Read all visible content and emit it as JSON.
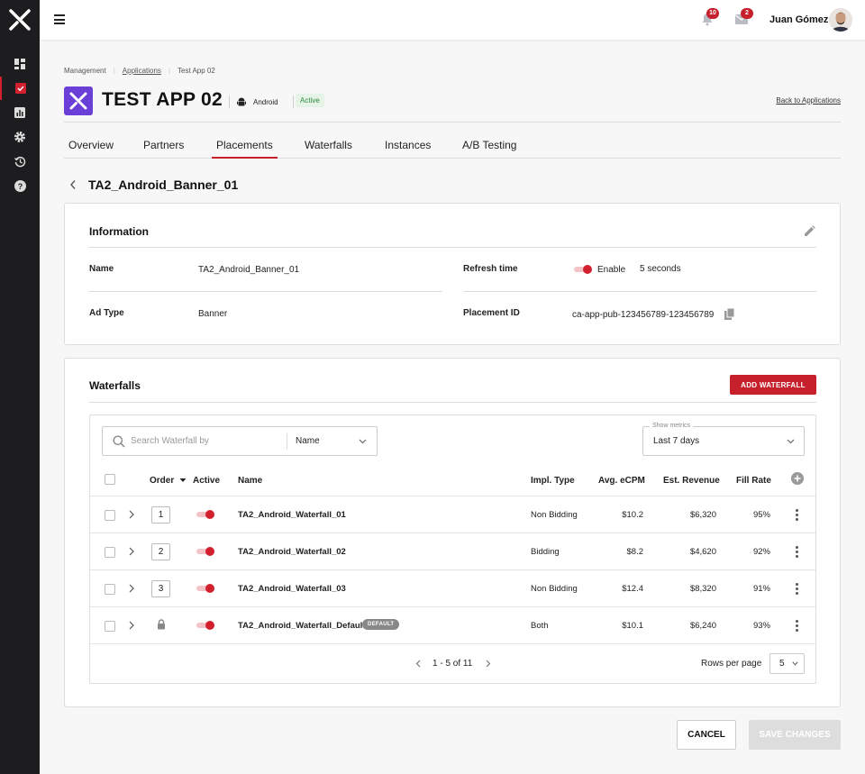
{
  "colors": {
    "brand_red": "#c6202d",
    "app_purple": "#6a3fd8",
    "sidebar": "#1d1d1f",
    "active_green": "#2e8a3d"
  },
  "sidebar": {
    "items": [
      {
        "icon": "dashboard-icon",
        "active": false
      },
      {
        "icon": "checkbox-icon",
        "active": true
      },
      {
        "icon": "bar-chart-icon",
        "active": false
      },
      {
        "icon": "gear-icon",
        "active": false
      },
      {
        "icon": "history-icon",
        "active": false
      },
      {
        "icon": "help-icon",
        "active": false
      }
    ]
  },
  "topbar": {
    "notifications_count": "10",
    "messages_count": "2",
    "user_name": "Juan Gómez"
  },
  "breadcrumb": {
    "items": [
      "Management",
      "Applications",
      "Test App 02"
    ]
  },
  "app": {
    "title": "TEST APP 02",
    "platform": "Android",
    "status": "Active",
    "back_link": "Back to Applications"
  },
  "tabs": [
    {
      "label": "Overview",
      "active": false
    },
    {
      "label": "Partners",
      "active": false
    },
    {
      "label": "Placements",
      "active": true
    },
    {
      "label": "Waterfalls",
      "active": false
    },
    {
      "label": "Instances",
      "active": false
    },
    {
      "label": "A/B Testing",
      "active": false
    }
  ],
  "placement": {
    "title": "TA2_Android_Banner_01"
  },
  "information": {
    "title": "Information",
    "name_label": "Name",
    "name_value": "TA2_Android_Banner_01",
    "ad_type_label": "Ad Type",
    "ad_type_value": "Banner",
    "refresh_label": "Refresh time",
    "refresh_toggle_label": "Enable",
    "refresh_enabled": true,
    "refresh_value": "5 seconds",
    "placement_id_label": "Placement ID",
    "placement_id_value": "ca-app-pub-123456789-123456789"
  },
  "waterfalls": {
    "title": "Waterfalls",
    "add_button": "ADD WATERFALL",
    "search_placeholder": "Search Waterfall by",
    "search_by": "Name",
    "metrics_label": "Show metrics",
    "metrics_value": "Last 7 days",
    "columns": {
      "order": "Order",
      "active": "Active",
      "name": "Name",
      "impl_type": "Impl. Type",
      "avg_ecpm": "Avg. eCPM",
      "est_revenue": "Est. Revenue",
      "fill_rate": "Fill Rate"
    },
    "rows": [
      {
        "order": "1",
        "active": true,
        "name": "TA2_Android_Waterfall_01",
        "impl_type": "Non Bidding",
        "avg_ecpm": "$10.2",
        "est_revenue": "$6,320",
        "fill_rate": "95%",
        "locked": false
      },
      {
        "order": "2",
        "active": true,
        "name": "TA2_Android_Waterfall_02",
        "impl_type": "Bidding",
        "avg_ecpm": "$8.2",
        "est_revenue": "$4,620",
        "fill_rate": "92%",
        "locked": false
      },
      {
        "order": "3",
        "active": true,
        "name": "TA2_Android_Waterfall_03",
        "impl_type": "Non Bidding",
        "avg_ecpm": "$12.4",
        "est_revenue": "$8,320",
        "fill_rate": "91%",
        "locked": false
      },
      {
        "order": "",
        "active": true,
        "name": "TA2_Android_Waterfall_Default",
        "tag": "DEFAULT",
        "impl_type": "Both",
        "avg_ecpm": "$10.1",
        "est_revenue": "$6,240",
        "fill_rate": "93%",
        "locked": true
      }
    ],
    "pagination": "1 - 5 of 11",
    "rows_per_page_label": "Rows per page",
    "rows_per_page": "5"
  },
  "footer": {
    "cancel": "CANCEL",
    "save": "SAVE CHANGES"
  }
}
